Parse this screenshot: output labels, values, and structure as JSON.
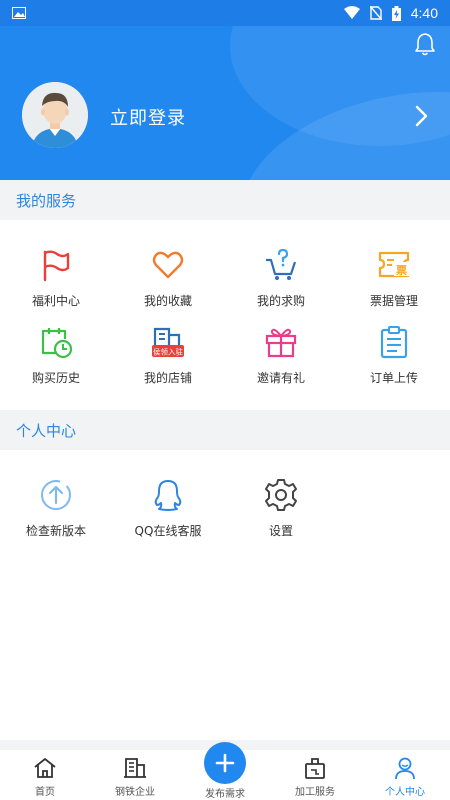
{
  "status_bar": {
    "time": "4:40"
  },
  "header": {
    "login_label": "立即登录"
  },
  "my_services": {
    "title": "我的服务",
    "items": [
      {
        "label": "福利中心",
        "icon": "flag-icon"
      },
      {
        "label": "我的收藏",
        "icon": "heart-icon"
      },
      {
        "label": "我的求购",
        "icon": "cart-question-icon"
      },
      {
        "label": "票据管理",
        "icon": "ticket-icon",
        "badge": "票"
      },
      {
        "label": "购买历史",
        "icon": "calendar-clock-icon"
      },
      {
        "label": "我的店铺",
        "icon": "store-icon",
        "badge": "侯领入驻"
      },
      {
        "label": "邀请有礼",
        "icon": "gift-icon"
      },
      {
        "label": "订单上传",
        "icon": "clipboard-icon"
      }
    ]
  },
  "personal_center": {
    "title": "个人中心",
    "items": [
      {
        "label": "检查新版本",
        "icon": "upload-circle-icon"
      },
      {
        "label": "QQ在线客服",
        "icon": "qq-icon"
      },
      {
        "label": "设置",
        "icon": "gear-icon"
      }
    ]
  },
  "tabbar": {
    "tabs": [
      {
        "label": "首页",
        "icon": "home-icon"
      },
      {
        "label": "钢铁企业",
        "icon": "building-icon"
      },
      {
        "label": "发布需求",
        "icon": "plus-icon"
      },
      {
        "label": "加工服务",
        "icon": "processing-icon"
      },
      {
        "label": "个人中心",
        "icon": "person-icon"
      }
    ]
  },
  "colors": {
    "primary": "#2188f0",
    "section_title": "#2e86de",
    "red": "#e8403a",
    "orange": "#f07b2c",
    "green": "#3dbf4a",
    "pink": "#ea3d8c",
    "sky": "#3aa0e8",
    "ticket": "#f5a623"
  }
}
